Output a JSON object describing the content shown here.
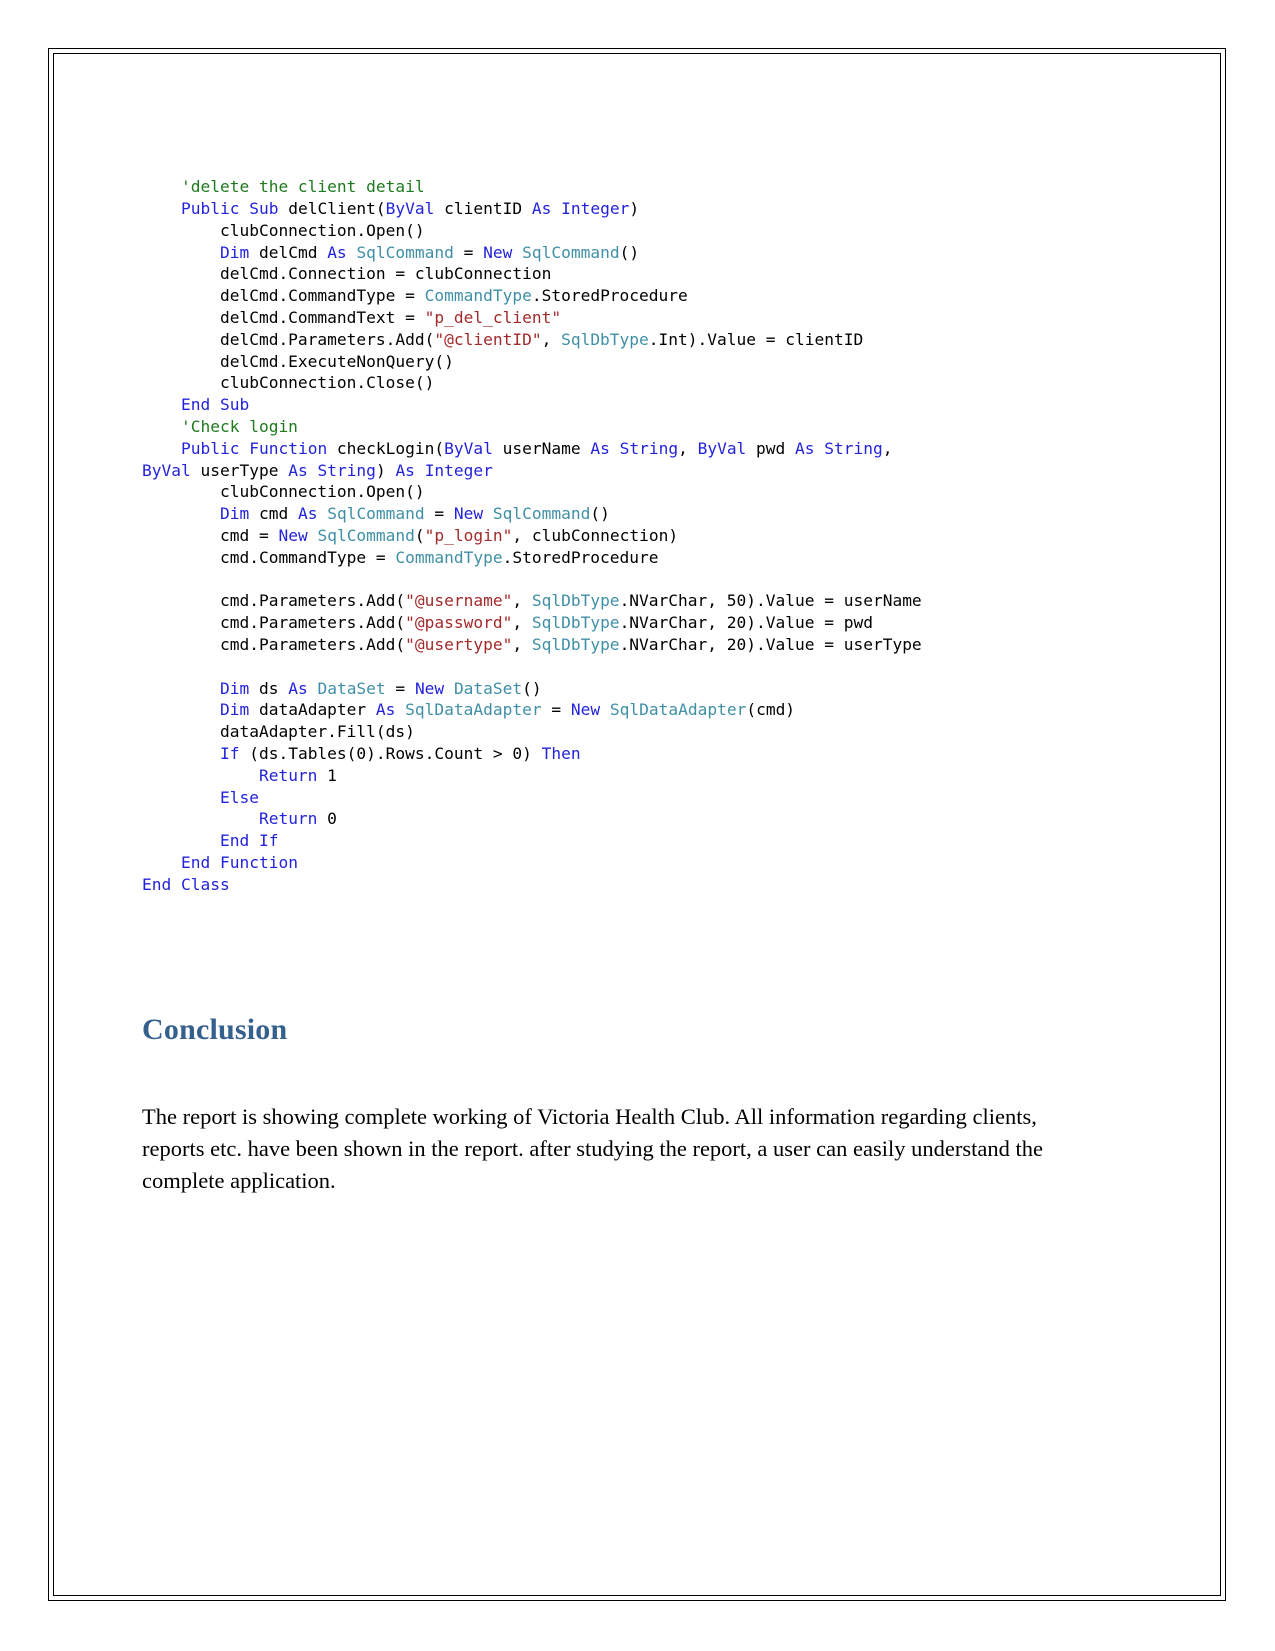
{
  "document": {
    "page_border_color": "#000000",
    "background_color": "#ffffff"
  },
  "code": {
    "language": "VB.NET",
    "theme": {
      "comment_color": "#1f7a1f",
      "keyword_color": "#2323dc",
      "type_color": "#3f8fa6",
      "string_color": "#a32a2a",
      "plain_color": "#000000"
    },
    "lines": [
      [
        {
          "t": "    ",
          "c": "pln"
        },
        {
          "t": "'delete the client detail",
          "c": "cmt"
        }
      ],
      [
        {
          "t": "    ",
          "c": "pln"
        },
        {
          "t": "Public",
          "c": "kw"
        },
        {
          "t": " ",
          "c": "pln"
        },
        {
          "t": "Sub",
          "c": "kw"
        },
        {
          "t": " delClient(",
          "c": "pln"
        },
        {
          "t": "ByVal",
          "c": "kw"
        },
        {
          "t": " clientID ",
          "c": "pln"
        },
        {
          "t": "As",
          "c": "kw"
        },
        {
          "t": " ",
          "c": "pln"
        },
        {
          "t": "Integer",
          "c": "kw"
        },
        {
          "t": ")",
          "c": "pln"
        }
      ],
      [
        {
          "t": "        clubConnection.Open()",
          "c": "pln"
        }
      ],
      [
        {
          "t": "        ",
          "c": "pln"
        },
        {
          "t": "Dim",
          "c": "kw"
        },
        {
          "t": " delCmd ",
          "c": "pln"
        },
        {
          "t": "As",
          "c": "kw"
        },
        {
          "t": " ",
          "c": "pln"
        },
        {
          "t": "SqlCommand",
          "c": "typ"
        },
        {
          "t": " = ",
          "c": "pln"
        },
        {
          "t": "New",
          "c": "kw"
        },
        {
          "t": " ",
          "c": "pln"
        },
        {
          "t": "SqlCommand",
          "c": "typ"
        },
        {
          "t": "()",
          "c": "pln"
        }
      ],
      [
        {
          "t": "        delCmd.Connection = clubConnection",
          "c": "pln"
        }
      ],
      [
        {
          "t": "        delCmd.CommandType = ",
          "c": "pln"
        },
        {
          "t": "CommandType",
          "c": "typ"
        },
        {
          "t": ".StoredProcedure",
          "c": "pln"
        }
      ],
      [
        {
          "t": "        delCmd.CommandText = ",
          "c": "pln"
        },
        {
          "t": "\"p_del_client\"",
          "c": "str"
        }
      ],
      [
        {
          "t": "        delCmd.Parameters.Add(",
          "c": "pln"
        },
        {
          "t": "\"@clientID\"",
          "c": "str"
        },
        {
          "t": ", ",
          "c": "pln"
        },
        {
          "t": "SqlDbType",
          "c": "typ"
        },
        {
          "t": ".Int).Value = clientID",
          "c": "pln"
        }
      ],
      [
        {
          "t": "        delCmd.ExecuteNonQuery()",
          "c": "pln"
        }
      ],
      [
        {
          "t": "        clubConnection.Close()",
          "c": "pln"
        }
      ],
      [
        {
          "t": "    ",
          "c": "pln"
        },
        {
          "t": "End",
          "c": "kw"
        },
        {
          "t": " ",
          "c": "pln"
        },
        {
          "t": "Sub",
          "c": "kw"
        }
      ],
      [
        {
          "t": "    ",
          "c": "pln"
        },
        {
          "t": "'Check login",
          "c": "cmt"
        }
      ],
      [
        {
          "t": "    ",
          "c": "pln"
        },
        {
          "t": "Public",
          "c": "kw"
        },
        {
          "t": " ",
          "c": "pln"
        },
        {
          "t": "Function",
          "c": "kw"
        },
        {
          "t": " checkLogin(",
          "c": "pln"
        },
        {
          "t": "ByVal",
          "c": "kw"
        },
        {
          "t": " userName ",
          "c": "pln"
        },
        {
          "t": "As",
          "c": "kw"
        },
        {
          "t": " ",
          "c": "pln"
        },
        {
          "t": "String",
          "c": "kw"
        },
        {
          "t": ", ",
          "c": "pln"
        },
        {
          "t": "ByVal",
          "c": "kw"
        },
        {
          "t": " pwd ",
          "c": "pln"
        },
        {
          "t": "As",
          "c": "kw"
        },
        {
          "t": " ",
          "c": "pln"
        },
        {
          "t": "String",
          "c": "kw"
        },
        {
          "t": ",",
          "c": "pln"
        }
      ],
      [
        {
          "t": "ByVal",
          "c": "kw"
        },
        {
          "t": " userType ",
          "c": "pln"
        },
        {
          "t": "As",
          "c": "kw"
        },
        {
          "t": " ",
          "c": "pln"
        },
        {
          "t": "String",
          "c": "kw"
        },
        {
          "t": ") ",
          "c": "pln"
        },
        {
          "t": "As",
          "c": "kw"
        },
        {
          "t": " ",
          "c": "pln"
        },
        {
          "t": "Integer",
          "c": "kw"
        }
      ],
      [
        {
          "t": "        clubConnection.Open()",
          "c": "pln"
        }
      ],
      [
        {
          "t": "        ",
          "c": "pln"
        },
        {
          "t": "Dim",
          "c": "kw"
        },
        {
          "t": " cmd ",
          "c": "pln"
        },
        {
          "t": "As",
          "c": "kw"
        },
        {
          "t": " ",
          "c": "pln"
        },
        {
          "t": "SqlCommand",
          "c": "typ"
        },
        {
          "t": " = ",
          "c": "pln"
        },
        {
          "t": "New",
          "c": "kw"
        },
        {
          "t": " ",
          "c": "pln"
        },
        {
          "t": "SqlCommand",
          "c": "typ"
        },
        {
          "t": "()",
          "c": "pln"
        }
      ],
      [
        {
          "t": "        cmd = ",
          "c": "pln"
        },
        {
          "t": "New",
          "c": "kw"
        },
        {
          "t": " ",
          "c": "pln"
        },
        {
          "t": "SqlCommand",
          "c": "typ"
        },
        {
          "t": "(",
          "c": "pln"
        },
        {
          "t": "\"p_login\"",
          "c": "str"
        },
        {
          "t": ", clubConnection)",
          "c": "pln"
        }
      ],
      [
        {
          "t": "        cmd.CommandType = ",
          "c": "pln"
        },
        {
          "t": "CommandType",
          "c": "typ"
        },
        {
          "t": ".StoredProcedure",
          "c": "pln"
        }
      ],
      [
        {
          "t": "",
          "c": "pln"
        }
      ],
      [
        {
          "t": "        cmd.Parameters.Add(",
          "c": "pln"
        },
        {
          "t": "\"@username\"",
          "c": "str"
        },
        {
          "t": ", ",
          "c": "pln"
        },
        {
          "t": "SqlDbType",
          "c": "typ"
        },
        {
          "t": ".NVarChar, 50).Value = userName",
          "c": "pln"
        }
      ],
      [
        {
          "t": "        cmd.Parameters.Add(",
          "c": "pln"
        },
        {
          "t": "\"@password\"",
          "c": "str"
        },
        {
          "t": ", ",
          "c": "pln"
        },
        {
          "t": "SqlDbType",
          "c": "typ"
        },
        {
          "t": ".NVarChar, 20).Value = pwd",
          "c": "pln"
        }
      ],
      [
        {
          "t": "        cmd.Parameters.Add(",
          "c": "pln"
        },
        {
          "t": "\"@usertype\"",
          "c": "str"
        },
        {
          "t": ", ",
          "c": "pln"
        },
        {
          "t": "SqlDbType",
          "c": "typ"
        },
        {
          "t": ".NVarChar, 20).Value = userType",
          "c": "pln"
        }
      ],
      [
        {
          "t": "",
          "c": "pln"
        }
      ],
      [
        {
          "t": "        ",
          "c": "pln"
        },
        {
          "t": "Dim",
          "c": "kw"
        },
        {
          "t": " ds ",
          "c": "pln"
        },
        {
          "t": "As",
          "c": "kw"
        },
        {
          "t": " ",
          "c": "pln"
        },
        {
          "t": "DataSet",
          "c": "typ"
        },
        {
          "t": " = ",
          "c": "pln"
        },
        {
          "t": "New",
          "c": "kw"
        },
        {
          "t": " ",
          "c": "pln"
        },
        {
          "t": "DataSet",
          "c": "typ"
        },
        {
          "t": "()",
          "c": "pln"
        }
      ],
      [
        {
          "t": "        ",
          "c": "pln"
        },
        {
          "t": "Dim",
          "c": "kw"
        },
        {
          "t": " dataAdapter ",
          "c": "pln"
        },
        {
          "t": "As",
          "c": "kw"
        },
        {
          "t": " ",
          "c": "pln"
        },
        {
          "t": "SqlDataAdapter",
          "c": "typ"
        },
        {
          "t": " = ",
          "c": "pln"
        },
        {
          "t": "New",
          "c": "kw"
        },
        {
          "t": " ",
          "c": "pln"
        },
        {
          "t": "SqlDataAdapter",
          "c": "typ"
        },
        {
          "t": "(cmd)",
          "c": "pln"
        }
      ],
      [
        {
          "t": "        dataAdapter.Fill(ds)",
          "c": "pln"
        }
      ],
      [
        {
          "t": "        ",
          "c": "pln"
        },
        {
          "t": "If",
          "c": "kw"
        },
        {
          "t": " (ds.Tables(0).Rows.Count > 0) ",
          "c": "pln"
        },
        {
          "t": "Then",
          "c": "kw"
        }
      ],
      [
        {
          "t": "            ",
          "c": "pln"
        },
        {
          "t": "Return",
          "c": "kw"
        },
        {
          "t": " 1",
          "c": "pln"
        }
      ],
      [
        {
          "t": "        ",
          "c": "pln"
        },
        {
          "t": "Else",
          "c": "kw"
        }
      ],
      [
        {
          "t": "            ",
          "c": "pln"
        },
        {
          "t": "Return",
          "c": "kw"
        },
        {
          "t": " 0",
          "c": "pln"
        }
      ],
      [
        {
          "t": "        ",
          "c": "pln"
        },
        {
          "t": "End",
          "c": "kw"
        },
        {
          "t": " ",
          "c": "pln"
        },
        {
          "t": "If",
          "c": "kw"
        }
      ],
      [
        {
          "t": "    ",
          "c": "pln"
        },
        {
          "t": "End",
          "c": "kw"
        },
        {
          "t": " ",
          "c": "pln"
        },
        {
          "t": "Function",
          "c": "kw"
        }
      ],
      [
        {
          "t": "End",
          "c": "kw"
        },
        {
          "t": " ",
          "c": "pln"
        },
        {
          "t": "Class",
          "c": "kw"
        }
      ]
    ]
  },
  "conclusion": {
    "heading": "Conclusion",
    "heading_color": "#35608e",
    "paragraph": "The report is showing complete working of Victoria Health Club. All information regarding clients, reports etc. have been shown in the report. after studying the report, a user can easily understand the complete application."
  }
}
